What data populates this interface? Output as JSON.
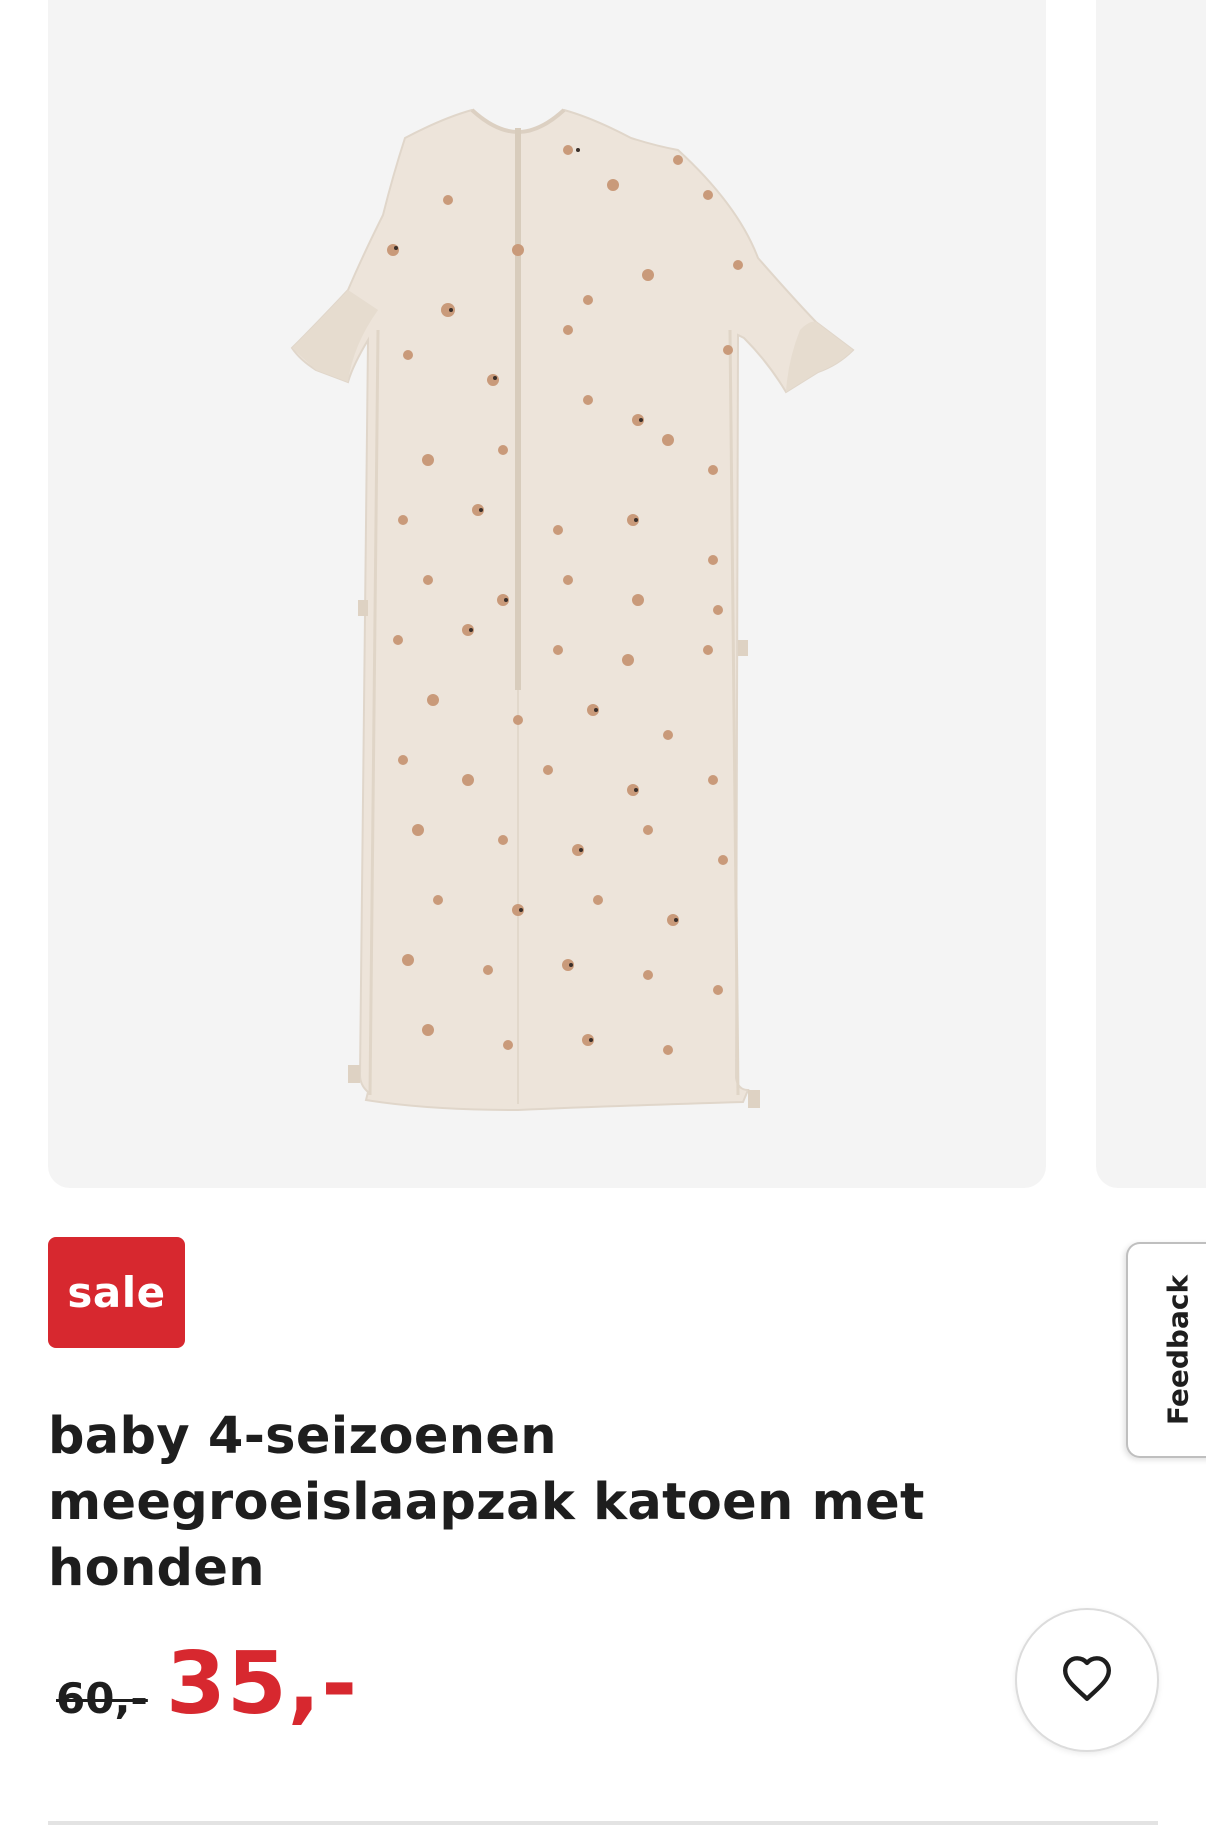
{
  "product": {
    "badge": "sale",
    "title": "baby 4-seizoenen meegroeislaapzak katoen met honden",
    "old_price": "60,-",
    "new_price": "35,-"
  },
  "feedback": {
    "label": "Feedback"
  },
  "icons": {
    "wishlist": "heart-outline-icon",
    "sale_color": "#d7282f"
  }
}
